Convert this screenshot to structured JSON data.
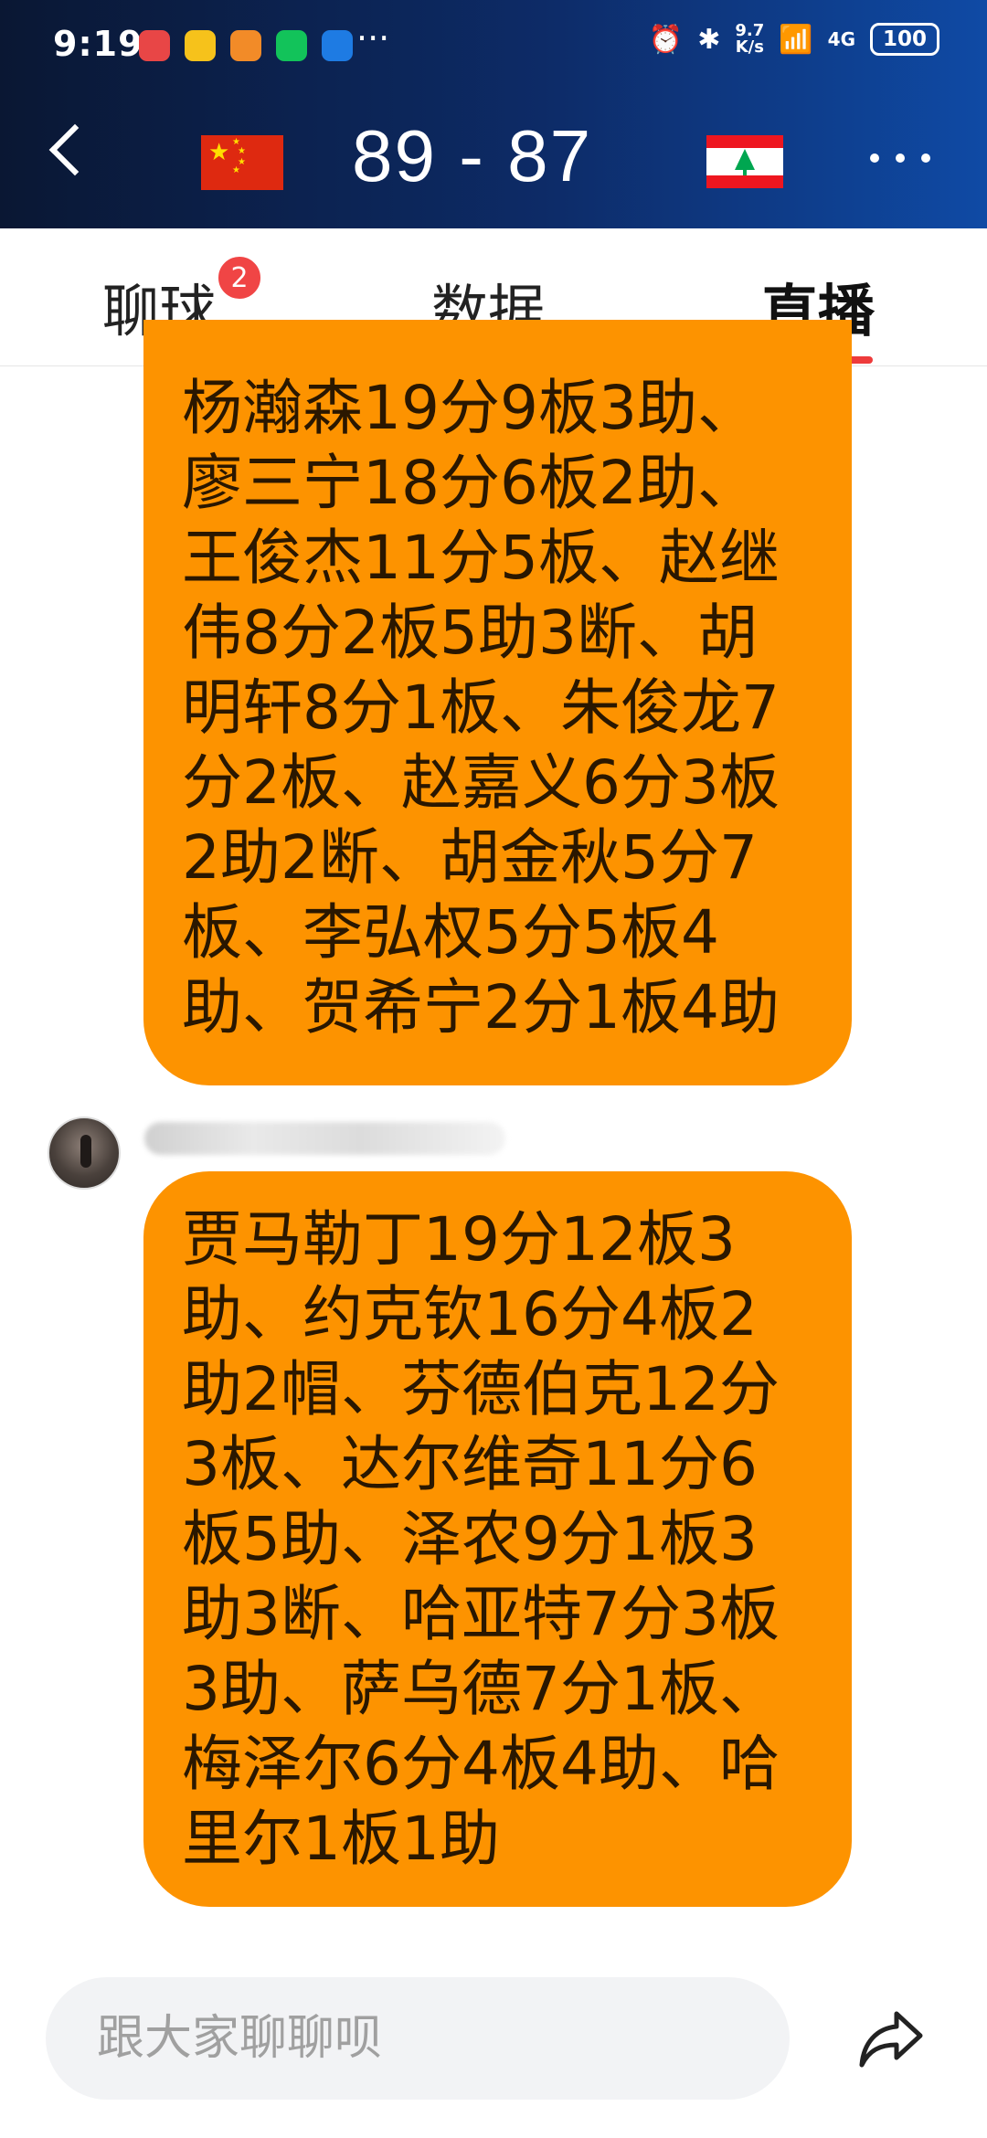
{
  "status_bar": {
    "time": "9:19",
    "more": "···",
    "net_speed_value": "9.7",
    "net_speed_unit": "K/s",
    "network": "4G",
    "battery": "100"
  },
  "header": {
    "score": "89 - 87",
    "home_flag": "china-flag",
    "away_flag": "lebanon-flag"
  },
  "tabs": [
    {
      "label": "聊球",
      "badge": "2"
    },
    {
      "label": "数据"
    },
    {
      "label": "直播",
      "active": true
    }
  ],
  "messages": [
    {
      "text": "杨瀚森19分9板3助、廖三宁18分6板2助、王俊杰11分5板、赵继伟8分2板5助3断、胡明轩8分1板、朱俊龙7分2板、赵嘉义6分3板2助2断、胡金秋5分7板、李弘权5分5板4助、贺希宁2分1板4助"
    },
    {
      "text": "贾马勒丁19分12板3助、约克钦16分4板2助2帽、芬德伯克12分3板、达尔维奇11分6板5助、泽农9分1板3助3断、哈亚特7分3板3助、萨乌德7分1板、梅泽尔6分4板4助、哈里尔1板1助"
    }
  ],
  "input": {
    "placeholder": "跟大家聊聊呗"
  },
  "colors": {
    "bubble": "#fd9300",
    "tab_indicator": "#ee3b3b",
    "badge": "#f04545"
  }
}
